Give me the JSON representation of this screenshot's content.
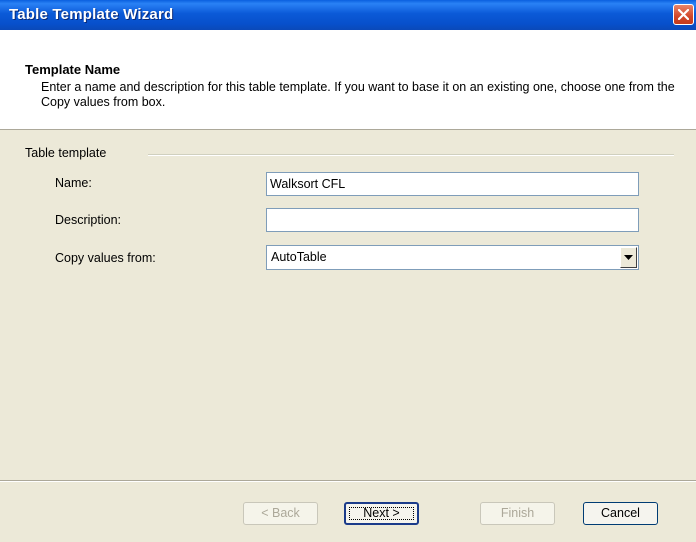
{
  "window": {
    "title": "Table Template Wizard"
  },
  "header": {
    "title": "Template Name",
    "description": "Enter a name and description for this table template. If you want to base it on an existing one, choose one from the Copy values from box."
  },
  "group": {
    "label": "Table template"
  },
  "form": {
    "name_label": "Name:",
    "name_value": "Walksort CFL",
    "description_label": "Description:",
    "description_value": "",
    "copy_label": "Copy values from:",
    "copy_value": "AutoTable"
  },
  "buttons": {
    "back": "< Back",
    "next": "Next >",
    "finish": "Finish",
    "cancel": "Cancel"
  },
  "colors": {
    "titlebar": "#0a5fdf",
    "close": "#d2472a",
    "dialog_bg": "#ece9d8"
  },
  "icons": {
    "close": "close-icon",
    "dropdown": "chevron-down-icon"
  }
}
